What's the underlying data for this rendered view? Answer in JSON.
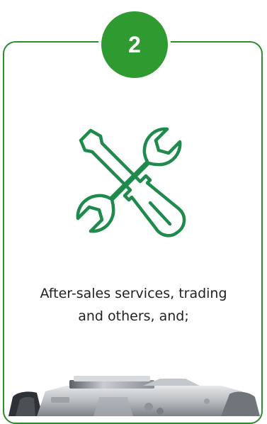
{
  "step": {
    "number": "2"
  },
  "icon": {
    "name": "wrench-screwdriver-icon",
    "color": "#1f8a4c"
  },
  "caption": {
    "line1": "After-sales services, trading",
    "line2": "and others, and;"
  },
  "colors": {
    "accent": "#2f9a2f",
    "card_border": "#2e8b2e",
    "text": "#222222"
  }
}
